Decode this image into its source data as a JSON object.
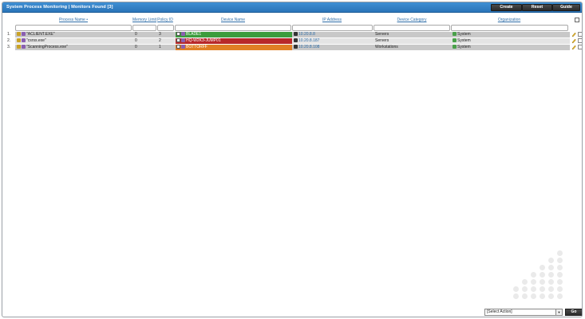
{
  "header": {
    "title": "System Process Monitoring | Monitors Found [3]",
    "buttons": {
      "create": "Create",
      "reset": "Reset",
      "guide": "Guide"
    }
  },
  "columns": {
    "process_name": "Process Name •",
    "memory_limit": "Memory Limit",
    "policy_id": "Policy ID",
    "device_name": "Device Name",
    "ip_address": "IP Address",
    "device_category": "Device Category",
    "organization": "Organization"
  },
  "rows": [
    {
      "num": "1.",
      "process": "\"ACLIENT.EXE\"",
      "memory": "0",
      "policy": "3",
      "device": "BLADE1",
      "ip": "10.20.8.8",
      "category": "Servers",
      "organization": "System",
      "device_color": "#3c9c3c"
    },
    {
      "num": "2.",
      "process": "\"csrss.exe\"",
      "memory": "0",
      "policy": "2",
      "device": "HQ-W2K3-JUMP01",
      "ip": "10.20.8.187",
      "category": "Servers",
      "organization": "System",
      "device_color": "#b8282a"
    },
    {
      "num": "3.",
      "process": "\"ScanningProcess.exe\"",
      "memory": "0",
      "policy": "1",
      "device": "BOTTORFF",
      "ip": "10.20.8.108",
      "category": "Workstations",
      "organization": "System",
      "device_color": "#e07f25"
    }
  ],
  "footer": {
    "select_action": "[Select Action]",
    "go": "Go"
  },
  "colors": {
    "titlebar": "#2a74b8",
    "link": "#2f6ea8"
  }
}
